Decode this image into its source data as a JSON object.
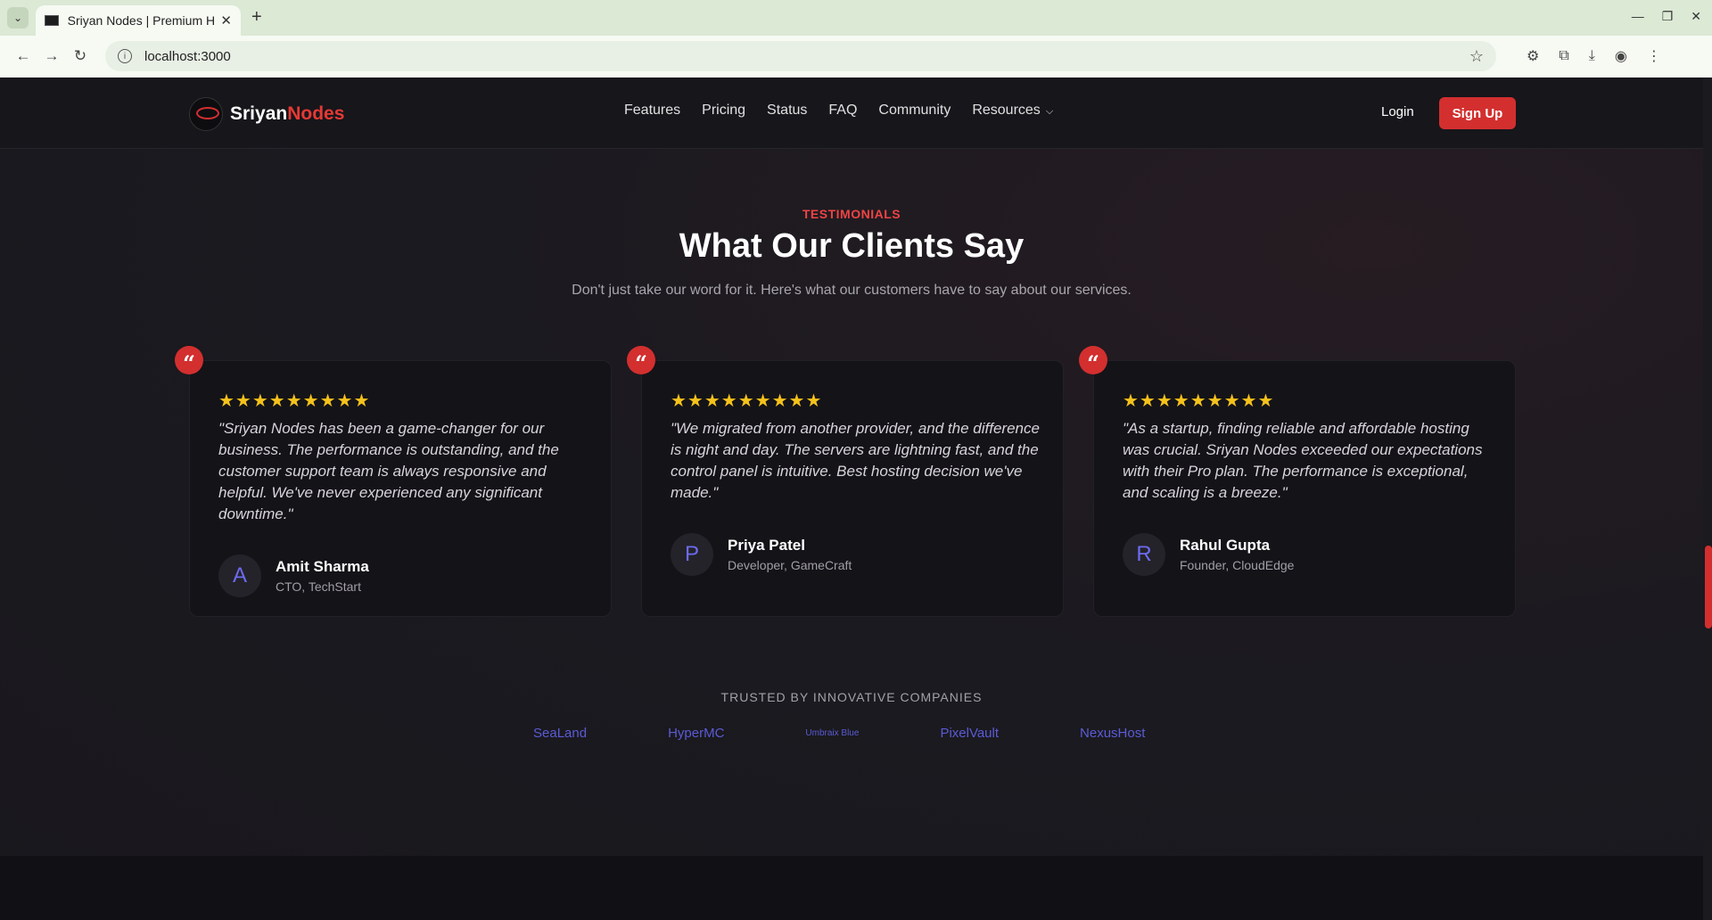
{
  "browser": {
    "tab_title": "Sriyan Nodes | Premium Hosting",
    "url": "localhost:3000"
  },
  "nav": {
    "brand_main": "Sriyan",
    "brand_accent": "Nodes",
    "links": [
      "Features",
      "Pricing",
      "Status",
      "FAQ",
      "Community",
      "Resources"
    ],
    "login": "Login",
    "signup": "Sign Up"
  },
  "testimonials": {
    "eyebrow": "TESTIMONIALS",
    "heading": "What Our Clients Say",
    "subheading": "Don't just take our word for it. Here's what our customers have to say about our services.",
    "cards": [
      {
        "stars": "★★★★★★★★★",
        "quote": "\"Sriyan Nodes has been a game-changer for our business. The performance is outstanding, and the customer support team is always responsive and helpful. We've never experienced any significant downtime.\"",
        "initial": "A",
        "name": "Amit Sharma",
        "role": "CTO, TechStart"
      },
      {
        "stars": "★★★★★★★★★",
        "quote": "\"We migrated from another provider, and the difference is night and day. The servers are lightning fast, and the control panel is intuitive. Best hosting decision we've made.\"",
        "initial": "P",
        "name": "Priya Patel",
        "role": "Developer, GameCraft"
      },
      {
        "stars": "★★★★★★★★★",
        "quote": "\"As a startup, finding reliable and affordable hosting was crucial. Sriyan Nodes exceeded our expectations with their Pro plan. The performance is exceptional, and scaling is a breeze.\"",
        "initial": "R",
        "name": "Rahul Gupta",
        "role": "Founder, CloudEdge"
      }
    ]
  },
  "trusted": {
    "label": "TRUSTED BY INNOVATIVE COMPANIES",
    "companies": [
      "SeaLand",
      "HyperMC",
      "Umbraix Blue",
      "PixelVault",
      "NexusHost"
    ]
  },
  "colors": {
    "accent": "#d32f2f",
    "star": "#f5c21b",
    "company": "#5b5bd6"
  }
}
